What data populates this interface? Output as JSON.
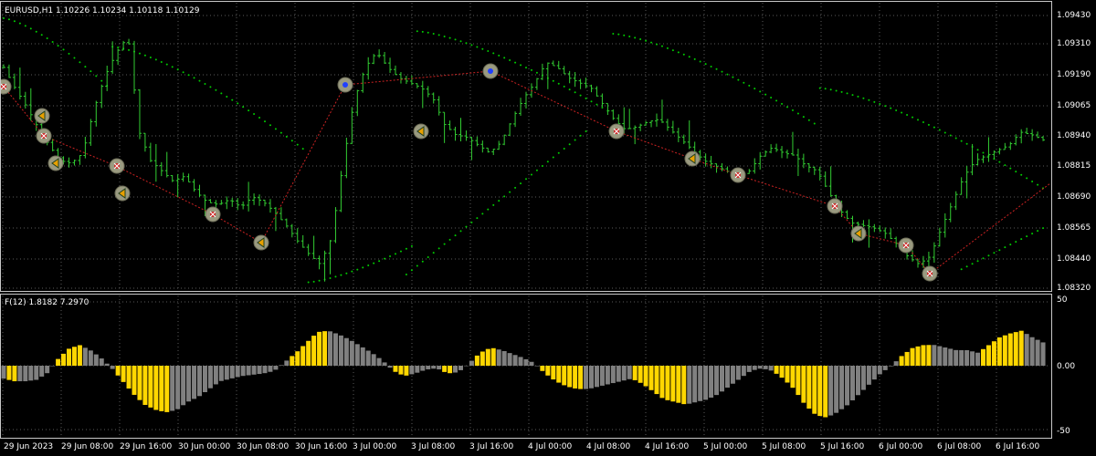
{
  "main_panel": {
    "header_text": "EURUSD,H1  1.10226 1.10234 1.10118 1.10129",
    "price_levels": [
      "1.09430",
      "1.09310",
      "1.09190",
      "1.09065",
      "1.08940",
      "1.08815",
      "1.08690",
      "1.08565",
      "1.08440",
      "1.08320"
    ]
  },
  "indicator_panel": {
    "header_text": "F(12) 1.8182 7.2970",
    "levels": [
      "50",
      "0.00",
      "-50"
    ]
  },
  "time_axis": {
    "labels": [
      "29 Jun 2023",
      "29 Jun 08:00",
      "29 Jun 16:00",
      "30 Jun 00:00",
      "30 Jun 08:00",
      "30 Jun 16:00",
      "3 Jul 00:00",
      "3 Jul 08:00",
      "3 Jul 16:00",
      "4 Jul 00:00",
      "4 Jul 08:00",
      "4 Jul 16:00",
      "5 Jul 00:00",
      "5 Jul 08:00",
      "5 Jul 16:00",
      "6 Jul 00:00",
      "6 Jul 08:00",
      "6 Jul 16:00"
    ]
  },
  "colors": {
    "background": "#000000",
    "frame": "#c8c8c8",
    "grid": "#5a5a5a",
    "bars": "#32cd32",
    "parabolic_sar": "#00cc00",
    "trend_line": "#cc2222",
    "histogram_up": "#ffd700",
    "histogram_base": "#808080",
    "marker_ring": "#9a9a80"
  },
  "chart_data": {
    "type": "bar",
    "symbol": "EURUSD",
    "timeframe": "H1",
    "ylim": [
      1.0832,
      1.0943
    ],
    "indicator_ylim": [
      -50,
      50
    ],
    "close_path": [
      1.0918,
      1.091,
      1.0903,
      1.0895,
      1.0888,
      1.0882,
      1.0881,
      1.0885,
      1.0902,
      1.0915,
      1.0924,
      1.093,
      1.0893,
      1.0882,
      1.0878,
      1.0874,
      1.0876,
      1.087,
      1.0866,
      1.0865,
      1.0867,
      1.0864,
      1.0868,
      1.0866,
      1.0862,
      1.0857,
      1.0851,
      1.0846,
      1.0842,
      1.0852,
      1.088,
      1.0905,
      1.0918,
      1.0924,
      1.0918,
      1.0914,
      1.0912,
      1.091,
      1.0906,
      1.0896,
      1.0892,
      1.0891,
      1.0888,
      1.0885,
      1.0889,
      1.0898,
      1.0906,
      1.0912,
      1.092,
      1.0918,
      1.0914,
      1.0912,
      1.091,
      1.0904,
      1.0898,
      1.0894,
      1.0895,
      1.0897,
      1.0898,
      1.0894,
      1.089,
      1.0886,
      1.0882,
      1.088,
      1.0878,
      1.0876,
      1.0878,
      1.0884,
      1.0887,
      1.0885,
      1.0884,
      1.088,
      1.0878,
      1.087,
      1.0863,
      1.0858,
      1.0857,
      1.0856,
      1.0854,
      1.085,
      1.0845,
      1.0842,
      1.0845,
      1.0856,
      1.0866,
      1.0876,
      1.0882,
      1.0884,
      1.0886,
      1.0888,
      1.0893,
      1.0892,
      1.089
    ],
    "indicator_path": [
      -10,
      -12,
      -12,
      -11,
      -6,
      5,
      13,
      16,
      12,
      6,
      -2,
      -12,
      -22,
      -30,
      -34,
      -36,
      -34,
      -28,
      -24,
      -18,
      -12,
      -10,
      -8,
      -7,
      -6,
      -4,
      3,
      10,
      18,
      26,
      27,
      24,
      20,
      15,
      10,
      4,
      -4,
      -8,
      -6,
      -3,
      -2,
      -6,
      -5,
      2,
      10,
      14,
      12,
      9,
      6,
      2,
      -6,
      -12,
      -16,
      -18,
      -18,
      -16,
      -14,
      -12,
      -10,
      -14,
      -20,
      -26,
      -28,
      -30,
      -28,
      -26,
      -22,
      -16,
      -10,
      -4,
      -2,
      -4,
      -10,
      -18,
      -30,
      -38,
      -40,
      -36,
      -30,
      -22,
      -14,
      -6,
      0,
      8,
      14,
      16,
      16,
      14,
      12,
      12,
      10,
      16,
      22,
      25,
      27,
      22,
      18
    ]
  }
}
